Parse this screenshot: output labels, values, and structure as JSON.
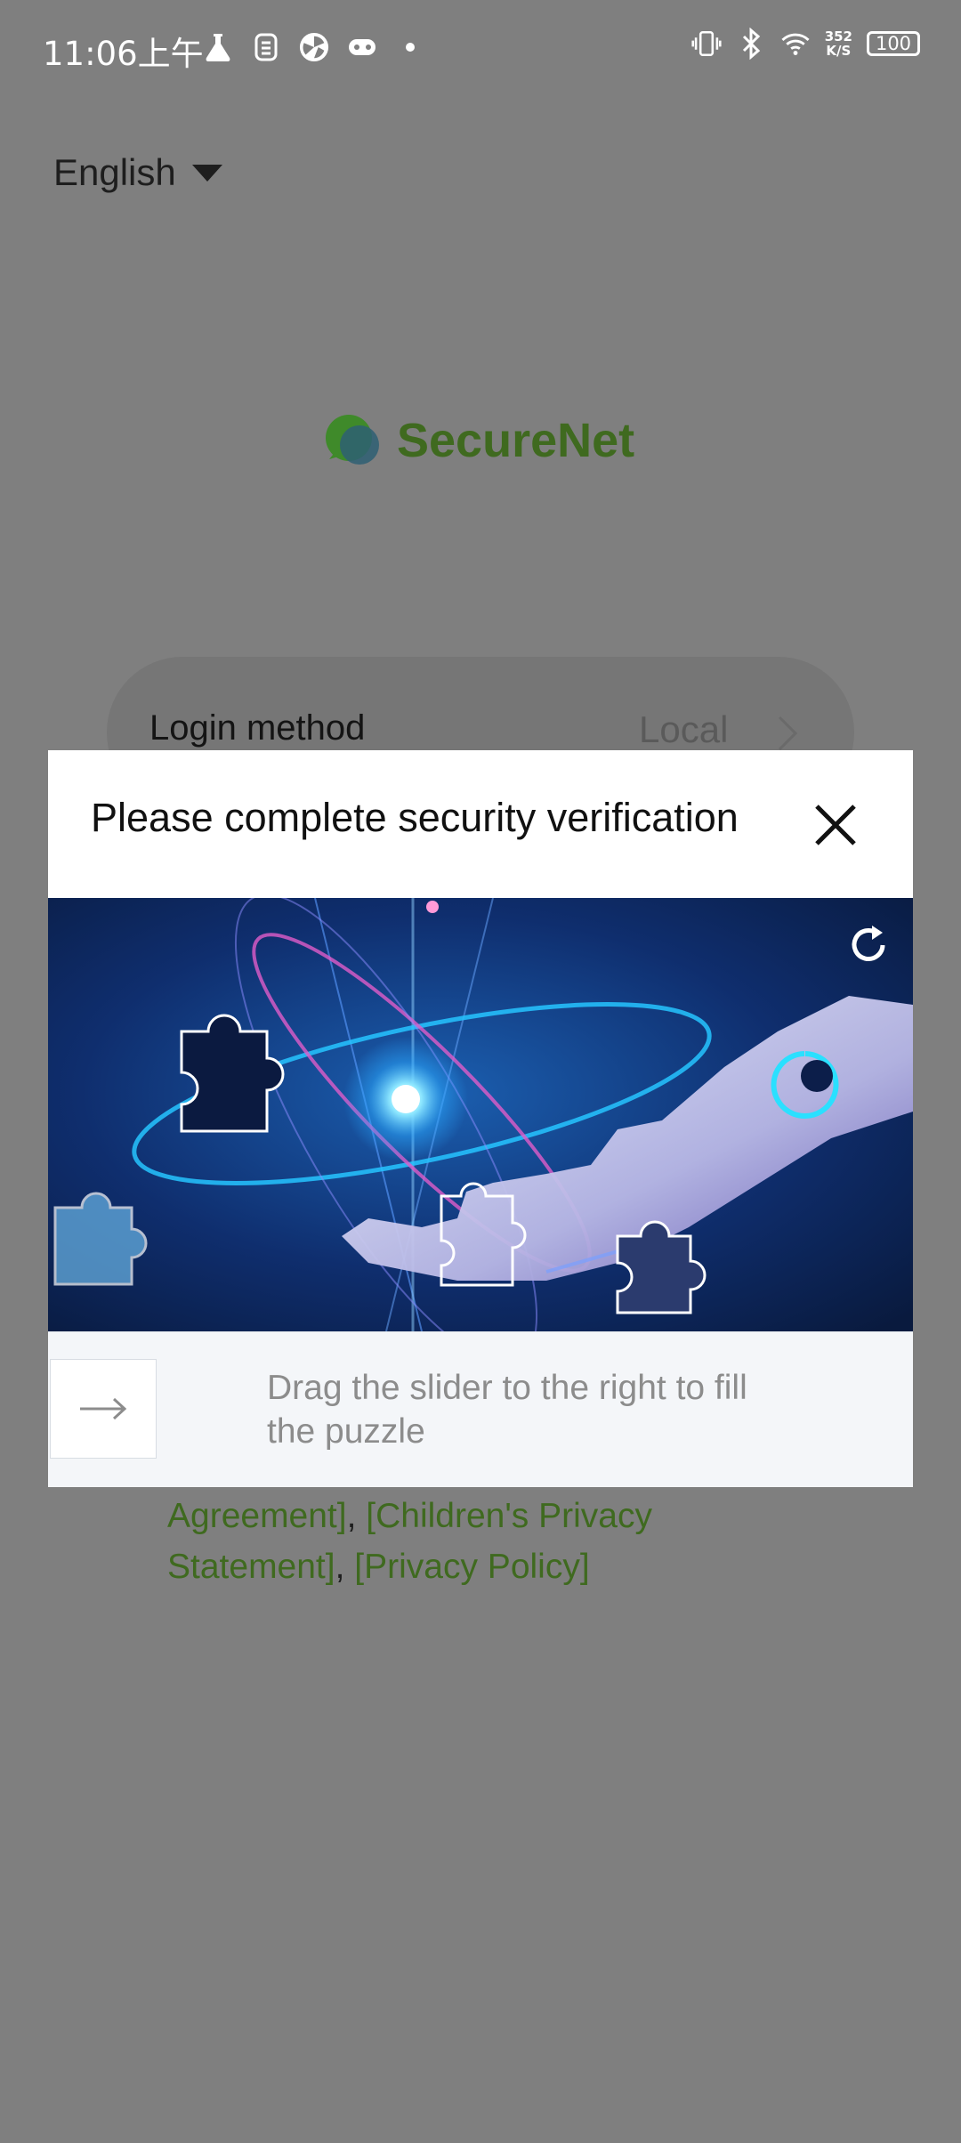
{
  "status_bar": {
    "time": "11:06上午",
    "net_speed_value": "352",
    "net_speed_unit": "K/S",
    "battery": "100"
  },
  "language": {
    "selected": "English"
  },
  "brand": {
    "name": "SecureNet",
    "color": "#3f6a1f"
  },
  "login": {
    "label": "Login method",
    "value": "Local"
  },
  "terms": {
    "line1_a": "Agreement]",
    "line1_sep": ", ",
    "line1_b": "[Children's Privacy",
    "line2_a": "Statement]",
    "line2_sep": ", ",
    "line2_b": "[Privacy Policy]"
  },
  "verification": {
    "title": "Please complete security verification",
    "hint": "Drag the slider to the right to fill the puzzle",
    "close_icon": "close-icon",
    "refresh_icon": "refresh-icon",
    "slider_icon": "arrow-right-icon",
    "slider_progress": 0
  }
}
